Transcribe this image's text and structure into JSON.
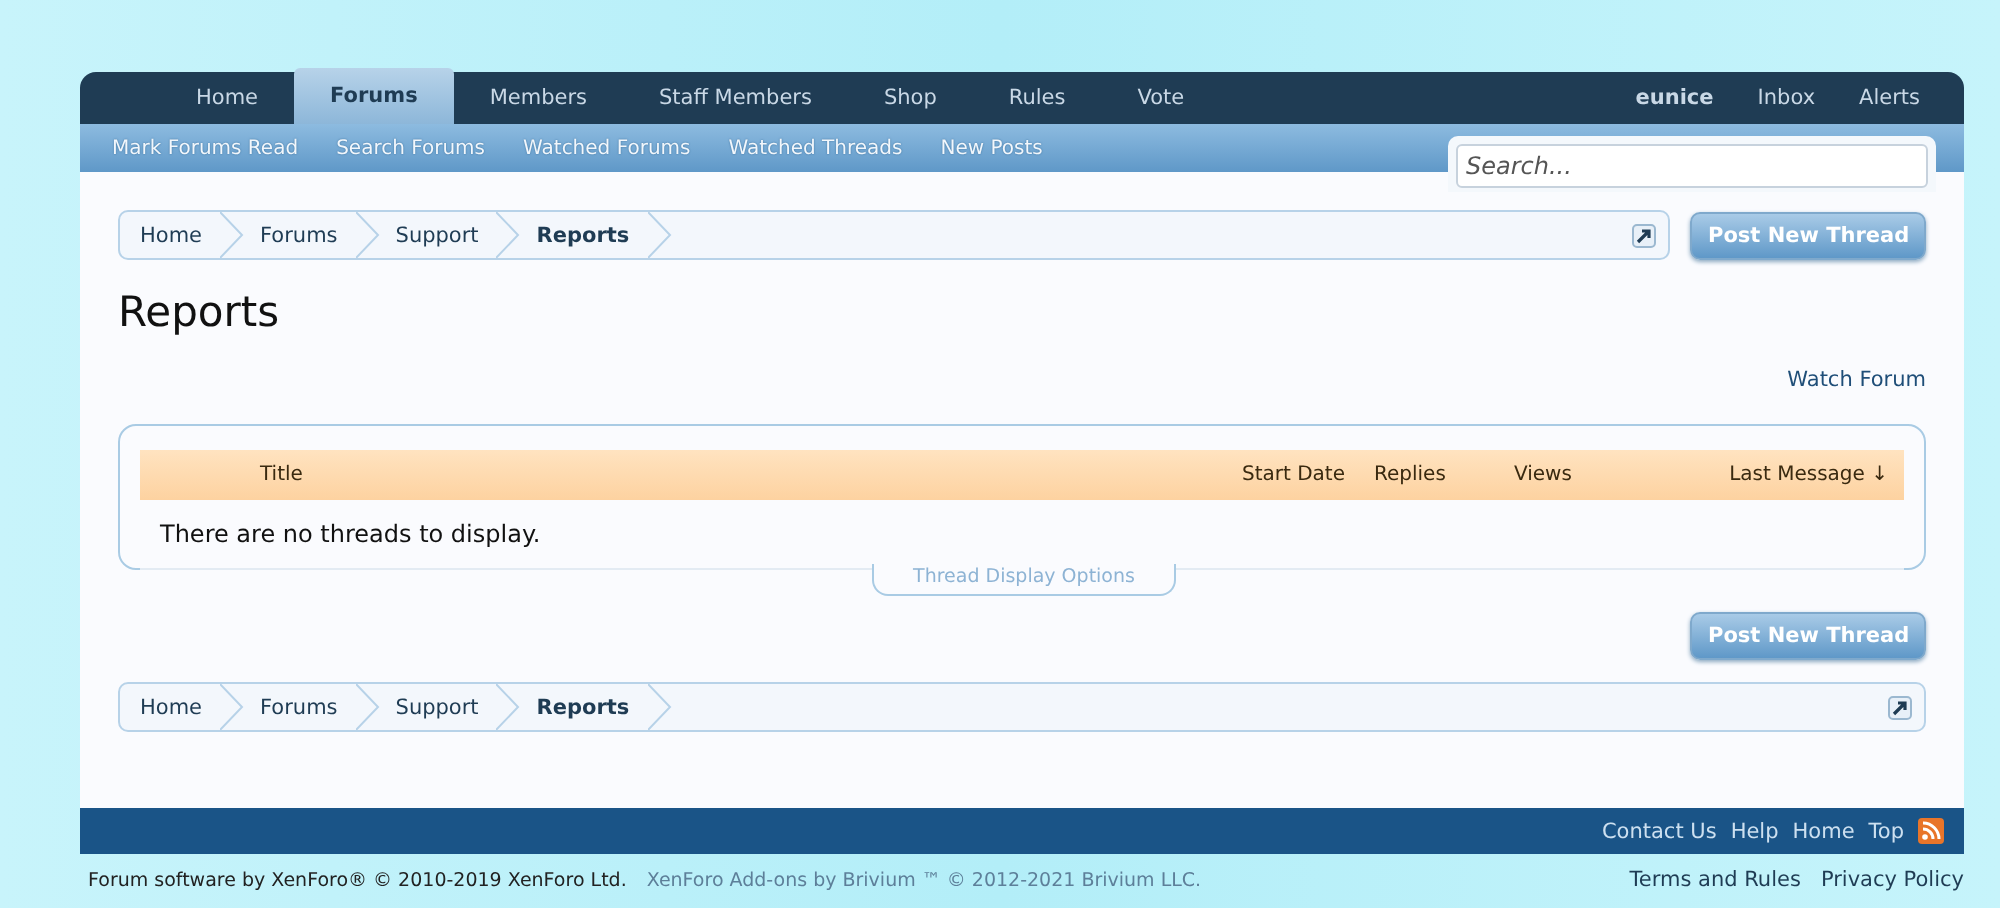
{
  "nav_tabs": [
    {
      "label": "Home",
      "selected": false
    },
    {
      "label": "Forums",
      "selected": true
    },
    {
      "label": "Members",
      "selected": false
    },
    {
      "label": "Staff Members",
      "selected": false
    },
    {
      "label": "Shop",
      "selected": false
    },
    {
      "label": "Rules",
      "selected": false
    },
    {
      "label": "Vote",
      "selected": false
    }
  ],
  "user_links": [
    "eunice",
    "Inbox",
    "Alerts"
  ],
  "sub_links": [
    "Mark Forums Read",
    "Search Forums",
    "Watched Forums",
    "Watched Threads",
    "New Posts"
  ],
  "search": {
    "placeholder": "Search..."
  },
  "breadcrumb_top": [
    {
      "label": "Home",
      "current": false
    },
    {
      "label": "Forums",
      "current": false
    },
    {
      "label": "Support",
      "current": false
    },
    {
      "label": "Reports",
      "current": true
    }
  ],
  "post_button": "Post New Thread",
  "title": "Reports",
  "watch_link": "Watch Forum",
  "table": {
    "columns": [
      "Title",
      "Start Date",
      "Replies",
      "Views",
      "Last Message ↓"
    ],
    "empty": "There are no threads to display.",
    "options": "Thread Display Options"
  },
  "post_button_bottom": "Post New Thread",
  "breadcrumb_bottom": [
    {
      "label": "Home",
      "current": false
    },
    {
      "label": "Forums",
      "current": false
    },
    {
      "label": "Support",
      "current": false
    },
    {
      "label": "Reports",
      "current": true
    }
  ],
  "footer_links": [
    "Contact Us",
    "Help",
    "Home",
    "Top"
  ],
  "copyright": "Forum software by XenForo® © 2010-2019 XenForo Ltd.",
  "addon_credit": "XenForo Add-ons by Brivium ™ © 2012-2021 Brivium LLC.",
  "legal_links": [
    "Terms and Rules",
    "Privacy Policy"
  ]
}
